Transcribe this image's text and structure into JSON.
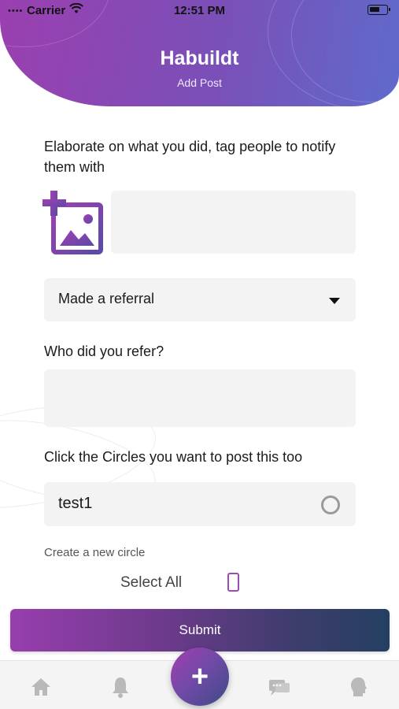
{
  "status_bar": {
    "carrier": "Carrier",
    "time": "12:51 PM",
    "signal_icon": "signal-dots-icon",
    "wifi_icon": "wifi-icon",
    "battery_icon": "battery-icon"
  },
  "header": {
    "title": "Habuildt",
    "subtitle": "Add Post"
  },
  "post": {
    "prompt": "Elaborate on what you did, tag people to notify them with",
    "text_value": "",
    "add_image_icon": "add-image-icon"
  },
  "activity": {
    "selected": "Made a referral"
  },
  "referral": {
    "question": "Who did you refer?",
    "value": ""
  },
  "circles": {
    "prompt": "Click the Circles you want to post this too",
    "items": [
      {
        "name": "test1",
        "selected": false
      }
    ],
    "create_link": "Create a new circle",
    "select_all_label": "Select All"
  },
  "submit_label": "Submit",
  "tabbar": {
    "icons": [
      "home-icon",
      "bell-icon",
      "plus-icon",
      "chat-icon",
      "profile-icon"
    ],
    "fab_symbol": "+"
  },
  "colors": {
    "brand_purple": "#9b3fb0",
    "brand_blue": "#5f6acb",
    "field_bg": "#f3f3f4",
    "submit_end": "#243f62"
  }
}
